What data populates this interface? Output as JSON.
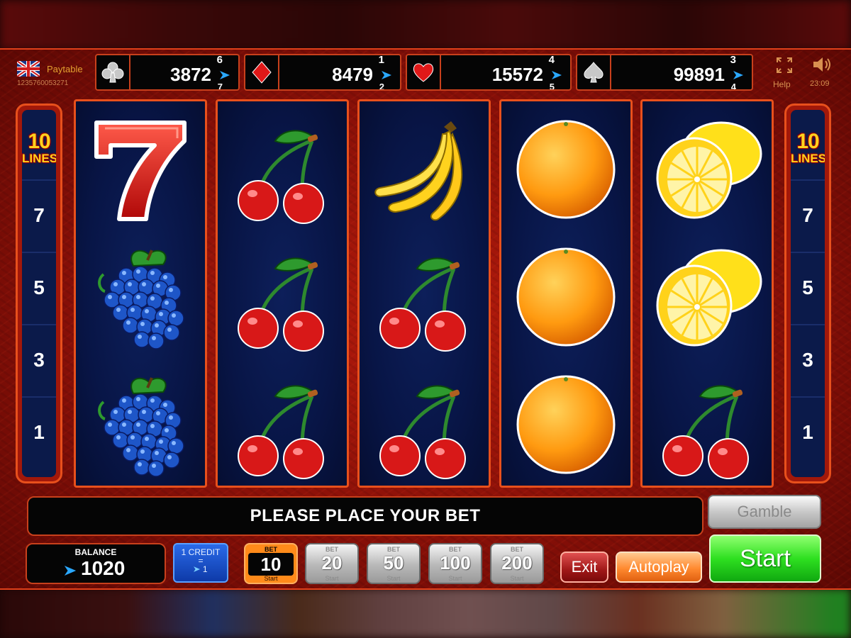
{
  "header": {
    "paytable_label": "Paytable",
    "game_id": "1235760053271",
    "help_label": "Help",
    "clock": "23:09"
  },
  "jackpots": [
    {
      "suit": "clubs",
      "value": "3872",
      "digit_top": "6",
      "digit_bottom": "7"
    },
    {
      "suit": "diamonds",
      "value": "8479",
      "digit_top": "1",
      "digit_bottom": "2"
    },
    {
      "suit": "hearts",
      "value": "15572",
      "digit_top": "4",
      "digit_bottom": "5"
    },
    {
      "suit": "spades",
      "value": "99891",
      "digit_top": "3",
      "digit_bottom": "4"
    }
  ],
  "side_panel": {
    "lines_count": "10",
    "lines_label": "LINES",
    "line_numbers": [
      "7",
      "5",
      "3",
      "1"
    ]
  },
  "reels": [
    [
      "seven",
      "grapes",
      "grapes"
    ],
    [
      "cherry",
      "cherry",
      "cherry"
    ],
    [
      "banana",
      "cherry",
      "cherry"
    ],
    [
      "orange",
      "orange",
      "orange"
    ],
    [
      "lemon",
      "lemon",
      "cherry"
    ]
  ],
  "message": "PLEASE PLACE YOUR BET",
  "balance": {
    "label": "BALANCE",
    "value": "1020"
  },
  "credit": {
    "line1": "1 CREDIT",
    "line2": "=",
    "line3": "1"
  },
  "bets": [
    {
      "label": "BET",
      "value": "10",
      "sub": "Start",
      "active": true
    },
    {
      "label": "BET",
      "value": "20",
      "sub": "Start",
      "active": false
    },
    {
      "label": "BET",
      "value": "50",
      "sub": "Start",
      "active": false
    },
    {
      "label": "BET",
      "value": "100",
      "sub": "Start",
      "active": false
    },
    {
      "label": "BET",
      "value": "200",
      "sub": "Start",
      "active": false
    }
  ],
  "buttons": {
    "gamble": "Gamble",
    "exit": "Exit",
    "autoplay": "Autoplay",
    "start": "Start"
  },
  "colors": {
    "frame": "#e8501c",
    "reel_bg": "#0b1a4a",
    "start": "#2ee020",
    "active_bet": "#ff8a1a"
  }
}
